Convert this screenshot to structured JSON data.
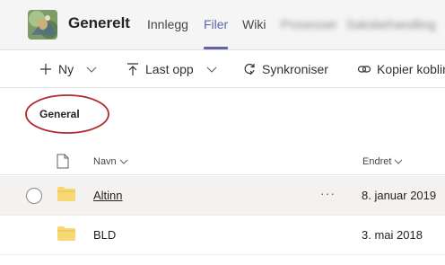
{
  "header": {
    "channel_name": "Generelt",
    "tabs": [
      {
        "label": "Innlegg",
        "active": false
      },
      {
        "label": "Filer",
        "active": true
      },
      {
        "label": "Wiki",
        "active": false
      },
      {
        "label": "Prosesser",
        "active": false,
        "blurred": true
      },
      {
        "label": "Saksbehandling",
        "active": false,
        "blurred": true
      }
    ],
    "accent_color": "#6264a7"
  },
  "toolbar": {
    "new_label": "Ny",
    "upload_label": "Last opp",
    "sync_label": "Synkroniser",
    "copy_link_label": "Kopier kobling"
  },
  "breadcrumb": {
    "folder_title": "General",
    "highlight_color": "#b02a2f"
  },
  "list": {
    "columns": {
      "name": "Navn",
      "modified": "Endret"
    },
    "rows": [
      {
        "name": "Altinn",
        "modified": "8. januar 2019",
        "hovered": true,
        "more_label": "···"
      },
      {
        "name": "BLD",
        "modified": "3. mai 2018",
        "hovered": false
      }
    ],
    "folder_color": "#f8d775"
  }
}
